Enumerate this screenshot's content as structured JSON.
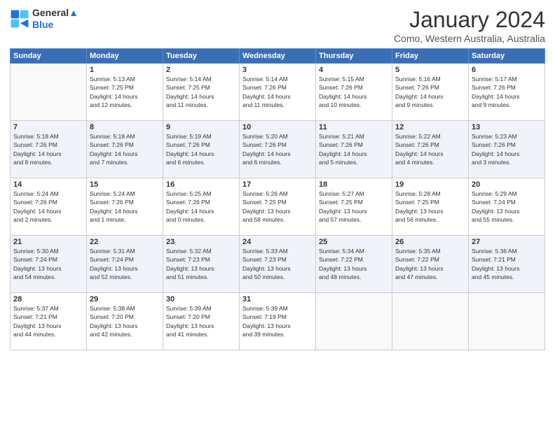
{
  "header": {
    "logo_line1": "General",
    "logo_line2": "Blue",
    "title": "January 2024",
    "subtitle": "Como, Western Australia, Australia"
  },
  "days_of_week": [
    "Sunday",
    "Monday",
    "Tuesday",
    "Wednesday",
    "Thursday",
    "Friday",
    "Saturday"
  ],
  "weeks": [
    [
      {
        "day": "",
        "info": ""
      },
      {
        "day": "1",
        "info": "Sunrise: 5:13 AM\nSunset: 7:25 PM\nDaylight: 14 hours\nand 12 minutes."
      },
      {
        "day": "2",
        "info": "Sunrise: 5:14 AM\nSunset: 7:25 PM\nDaylight: 14 hours\nand 11 minutes."
      },
      {
        "day": "3",
        "info": "Sunrise: 5:14 AM\nSunset: 7:26 PM\nDaylight: 14 hours\nand 11 minutes."
      },
      {
        "day": "4",
        "info": "Sunrise: 5:15 AM\nSunset: 7:26 PM\nDaylight: 14 hours\nand 10 minutes."
      },
      {
        "day": "5",
        "info": "Sunrise: 5:16 AM\nSunset: 7:26 PM\nDaylight: 14 hours\nand 9 minutes."
      },
      {
        "day": "6",
        "info": "Sunrise: 5:17 AM\nSunset: 7:26 PM\nDaylight: 14 hours\nand 9 minutes."
      }
    ],
    [
      {
        "day": "7",
        "info": "Sunrise: 5:18 AM\nSunset: 7:26 PM\nDaylight: 14 hours\nand 8 minutes."
      },
      {
        "day": "8",
        "info": "Sunrise: 5:18 AM\nSunset: 7:26 PM\nDaylight: 14 hours\nand 7 minutes."
      },
      {
        "day": "9",
        "info": "Sunrise: 5:19 AM\nSunset: 7:26 PM\nDaylight: 14 hours\nand 6 minutes."
      },
      {
        "day": "10",
        "info": "Sunrise: 5:20 AM\nSunset: 7:26 PM\nDaylight: 14 hours\nand 6 minutes."
      },
      {
        "day": "11",
        "info": "Sunrise: 5:21 AM\nSunset: 7:26 PM\nDaylight: 14 hours\nand 5 minutes."
      },
      {
        "day": "12",
        "info": "Sunrise: 5:22 AM\nSunset: 7:26 PM\nDaylight: 14 hours\nand 4 minutes."
      },
      {
        "day": "13",
        "info": "Sunrise: 5:23 AM\nSunset: 7:26 PM\nDaylight: 14 hours\nand 3 minutes."
      }
    ],
    [
      {
        "day": "14",
        "info": "Sunrise: 5:24 AM\nSunset: 7:26 PM\nDaylight: 14 hours\nand 2 minutes."
      },
      {
        "day": "15",
        "info": "Sunrise: 5:24 AM\nSunset: 7:26 PM\nDaylight: 14 hours\nand 1 minute."
      },
      {
        "day": "16",
        "info": "Sunrise: 5:25 AM\nSunset: 7:26 PM\nDaylight: 14 hours\nand 0 minutes."
      },
      {
        "day": "17",
        "info": "Sunrise: 5:26 AM\nSunset: 7:25 PM\nDaylight: 13 hours\nand 58 minutes."
      },
      {
        "day": "18",
        "info": "Sunrise: 5:27 AM\nSunset: 7:25 PM\nDaylight: 13 hours\nand 57 minutes."
      },
      {
        "day": "19",
        "info": "Sunrise: 5:28 AM\nSunset: 7:25 PM\nDaylight: 13 hours\nand 56 minutes."
      },
      {
        "day": "20",
        "info": "Sunrise: 5:29 AM\nSunset: 7:24 PM\nDaylight: 13 hours\nand 55 minutes."
      }
    ],
    [
      {
        "day": "21",
        "info": "Sunrise: 5:30 AM\nSunset: 7:24 PM\nDaylight: 13 hours\nand 54 minutes."
      },
      {
        "day": "22",
        "info": "Sunrise: 5:31 AM\nSunset: 7:24 PM\nDaylight: 13 hours\nand 52 minutes."
      },
      {
        "day": "23",
        "info": "Sunrise: 5:32 AM\nSunset: 7:23 PM\nDaylight: 13 hours\nand 51 minutes."
      },
      {
        "day": "24",
        "info": "Sunrise: 5:33 AM\nSunset: 7:23 PM\nDaylight: 13 hours\nand 50 minutes."
      },
      {
        "day": "25",
        "info": "Sunrise: 5:34 AM\nSunset: 7:22 PM\nDaylight: 13 hours\nand 48 minutes."
      },
      {
        "day": "26",
        "info": "Sunrise: 5:35 AM\nSunset: 7:22 PM\nDaylight: 13 hours\nand 47 minutes."
      },
      {
        "day": "27",
        "info": "Sunrise: 5:36 AM\nSunset: 7:21 PM\nDaylight: 13 hours\nand 45 minutes."
      }
    ],
    [
      {
        "day": "28",
        "info": "Sunrise: 5:37 AM\nSunset: 7:21 PM\nDaylight: 13 hours\nand 44 minutes."
      },
      {
        "day": "29",
        "info": "Sunrise: 5:38 AM\nSunset: 7:20 PM\nDaylight: 13 hours\nand 42 minutes."
      },
      {
        "day": "30",
        "info": "Sunrise: 5:39 AM\nSunset: 7:20 PM\nDaylight: 13 hours\nand 41 minutes."
      },
      {
        "day": "31",
        "info": "Sunrise: 5:39 AM\nSunset: 7:19 PM\nDaylight: 13 hours\nand 39 minutes."
      },
      {
        "day": "",
        "info": ""
      },
      {
        "day": "",
        "info": ""
      },
      {
        "day": "",
        "info": ""
      }
    ]
  ]
}
